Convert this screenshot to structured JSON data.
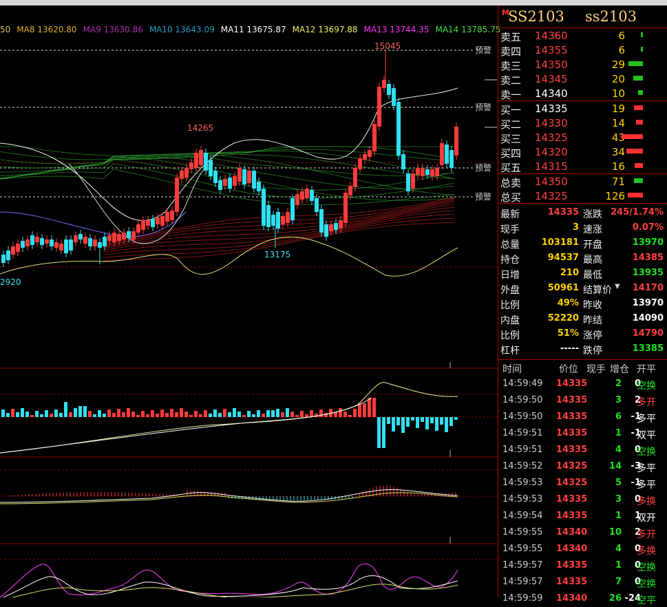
{
  "ma_legend": [
    {
      "text": "50",
      "color": "#e0c060"
    },
    {
      "text": "MA8 13620.80",
      "color": "#e0b020"
    },
    {
      "text": "MA9 13630.86",
      "color": "#b030b0"
    },
    {
      "text": "MA10 13643.09",
      "color": "#20a0c0"
    },
    {
      "text": "MA11 13675.87",
      "color": "#ffffff"
    },
    {
      "text": "MA12 13697.88",
      "color": "#f0f060"
    },
    {
      "text": "MA13 13744.35",
      "color": "#ff30ff"
    },
    {
      "text": "MA14 13785.75",
      "color": "#40e040"
    }
  ],
  "chart_labels": {
    "high": "15045",
    "mid_high": "14265",
    "low": "13175",
    "left_low": "2920",
    "alert1": "预警",
    "alert2": "预警",
    "alert3": "预警",
    "alert4": "预警"
  },
  "header": {
    "marker": "M",
    "title": "SS2103",
    "subtitle": "ss2103"
  },
  "order_book": {
    "asks": [
      {
        "label": "卖五",
        "price": "14360",
        "vol": "6",
        "bar": 0.03
      },
      {
        "label": "卖四",
        "price": "14355",
        "vol": "6",
        "bar": 0.03
      },
      {
        "label": "卖三",
        "price": "14350",
        "vol": "29",
        "bar": 0.23
      },
      {
        "label": "卖二",
        "price": "14345",
        "vol": "20",
        "bar": 0.16
      },
      {
        "label": "卖一",
        "price": "14340",
        "vol": "10",
        "bar": 0.08
      }
    ],
    "bids": [
      {
        "label": "买一",
        "price": "14335",
        "vol": "19",
        "bar": 0.15
      },
      {
        "label": "买二",
        "price": "14330",
        "vol": "14",
        "bar": 0.11
      },
      {
        "label": "买三",
        "price": "14325",
        "vol": "43",
        "bar": 0.34
      },
      {
        "label": "买四",
        "price": "14320",
        "vol": "34",
        "bar": 0.27
      },
      {
        "label": "买五",
        "price": "14315",
        "vol": "16",
        "bar": 0.13
      }
    ],
    "totals": [
      {
        "label": "总卖",
        "price": "14350",
        "vol": "71",
        "bar": 0.14,
        "color": "#20c020"
      },
      {
        "label": "总买",
        "price": "14325",
        "vol": "126",
        "bar": 0.25,
        "color": "#ff3030"
      }
    ]
  },
  "stats": {
    "last": {
      "k": "最新",
      "v": "14335"
    },
    "change": {
      "k": "涨跌",
      "v": "245/1.74%"
    },
    "cur_vol": {
      "k": "现手",
      "v": "3"
    },
    "speed": {
      "k": "速涨",
      "v": "0.07%"
    },
    "total_vol": {
      "k": "总量",
      "v": "103181"
    },
    "open": {
      "k": "开盘",
      "v": "13970"
    },
    "oi": {
      "k": "持仓",
      "v": "94537"
    },
    "high": {
      "k": "最高",
      "v": "14385"
    },
    "day_inc": {
      "k": "日增",
      "v": "210"
    },
    "low": {
      "k": "最低",
      "v": "13935"
    },
    "outer": {
      "k": "外盘",
      "v": "50961"
    },
    "settle_est": {
      "k": "结算价",
      "v": "14170"
    },
    "ratio1": {
      "k": "比例",
      "v": "49%"
    },
    "prev_close": {
      "k": "昨收",
      "v": "13970"
    },
    "inner": {
      "k": "内盘",
      "v": "52220"
    },
    "prev_settle": {
      "k": "昨结",
      "v": "14090"
    },
    "ratio2": {
      "k": "比例",
      "v": "51%"
    },
    "limit_up": {
      "k": "涨停",
      "v": "14790"
    },
    "leverage": {
      "k": "杠杆",
      "v": "-----"
    },
    "limit_down": {
      "k": "跌停",
      "v": "13385"
    }
  },
  "ticks_header": {
    "time": "时间",
    "price": "价位",
    "vol": "现手",
    "oi": "增仓",
    "type": "开平"
  },
  "ticks": [
    {
      "time": "14:59:49",
      "price": "14335",
      "vol": "2",
      "oi": "0",
      "type": "空换",
      "pc": "red",
      "tc": "grn"
    },
    {
      "time": "14:59:50",
      "price": "14335",
      "vol": "3",
      "oi": "2",
      "type": "多开",
      "pc": "red",
      "tc": "red"
    },
    {
      "time": "14:59:50",
      "price": "14335",
      "vol": "6",
      "oi": "-1",
      "type": "多平",
      "pc": "red",
      "tc": "wht"
    },
    {
      "time": "14:59:51",
      "price": "14335",
      "vol": "1",
      "oi": "-1",
      "type": "双平",
      "pc": "red",
      "tc": "wht"
    },
    {
      "time": "14:59:51",
      "price": "14335",
      "vol": "4",
      "oi": "0",
      "type": "空换",
      "pc": "red",
      "tc": "grn"
    },
    {
      "time": "14:59:52",
      "price": "14325",
      "vol": "14",
      "oi": "-3",
      "type": "多平",
      "pc": "red",
      "tc": "wht"
    },
    {
      "time": "14:59:53",
      "price": "14325",
      "vol": "5",
      "oi": "-1",
      "type": "多平",
      "pc": "red",
      "tc": "wht"
    },
    {
      "time": "14:59:53",
      "price": "14335",
      "vol": "3",
      "oi": "0",
      "type": "多换",
      "pc": "red",
      "tc": "red"
    },
    {
      "time": "14:59:54",
      "price": "14335",
      "vol": "1",
      "oi": "1",
      "type": "双开",
      "pc": "red",
      "tc": "wht"
    },
    {
      "time": "14:59:55",
      "price": "14340",
      "vol": "10",
      "oi": "2",
      "type": "多开",
      "pc": "red",
      "tc": "red"
    },
    {
      "time": "14:59:55",
      "price": "14340",
      "vol": "4",
      "oi": "0",
      "type": "多换",
      "pc": "red",
      "tc": "red"
    },
    {
      "time": "14:59:57",
      "price": "14335",
      "vol": "1",
      "oi": "0",
      "type": "空换",
      "pc": "red",
      "tc": "grn"
    },
    {
      "time": "14:59:57",
      "price": "14335",
      "vol": "7",
      "oi": "0",
      "type": "空换",
      "pc": "red",
      "tc": "grn"
    },
    {
      "time": "14:59:59",
      "price": "14340",
      "vol": "26",
      "oi": "-24",
      "type": "空平",
      "pc": "red",
      "tc": "grn"
    }
  ],
  "colors": {
    "up": "#ff3b3b",
    "down": "#30e0f0",
    "grid": "#8a0000"
  }
}
